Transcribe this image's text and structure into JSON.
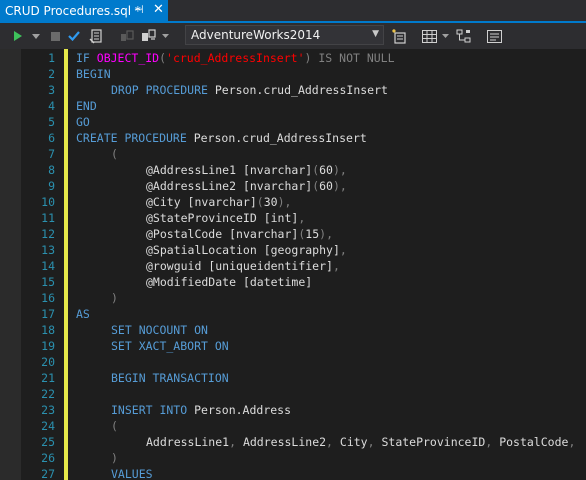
{
  "tab": {
    "title": "CRUD Procedures.sql *",
    "pin_glyph": "⊣",
    "close_glyph": "✕"
  },
  "toolbar": {
    "database": "AdventureWorks2014",
    "icons": [
      "execute-icon",
      "dropdown-icon",
      "stop-icon",
      "parse-check-icon",
      "display-plan-icon",
      "connect-icon",
      "change-connection-icon",
      "dropdown-arrow-icon",
      "query-options-icon",
      "results-grid-icon",
      "results-dropdown-icon",
      "include-plan-icon",
      "comment-icon"
    ]
  },
  "colors": {
    "keyword": "#569cd6",
    "function": "#ff00ff",
    "string": "#ff0000",
    "operator": "#808080",
    "line_number": "#2b91af",
    "change_marker": "#e5e84a",
    "accent": "#007acc"
  },
  "lines": [
    {
      "n": "1",
      "indent": 0,
      "tokens": [
        {
          "t": "IF ",
          "c": "kw"
        },
        {
          "t": "OBJECT_ID",
          "c": "fn"
        },
        {
          "t": "(",
          "c": "gray"
        },
        {
          "t": "'crud_AddressInsert'",
          "c": "str"
        },
        {
          "t": ") ",
          "c": "gray"
        },
        {
          "t": "IS NOT NULL",
          "c": "gray"
        }
      ]
    },
    {
      "n": "2",
      "indent": 0,
      "tokens": [
        {
          "t": "BEGIN",
          "c": "kw"
        }
      ]
    },
    {
      "n": "3",
      "indent": 5,
      "tokens": [
        {
          "t": "DROP PROCEDURE ",
          "c": "kw"
        },
        {
          "t": "Person.crud_AddressInsert",
          "c": "pl"
        }
      ]
    },
    {
      "n": "4",
      "indent": 0,
      "tokens": [
        {
          "t": "END",
          "c": "kw"
        }
      ]
    },
    {
      "n": "5",
      "indent": 0,
      "tokens": [
        {
          "t": "GO",
          "c": "kw"
        }
      ]
    },
    {
      "n": "6",
      "indent": 0,
      "tokens": [
        {
          "t": "CREATE PROCEDURE ",
          "c": "kw"
        },
        {
          "t": "Person.crud_AddressInsert",
          "c": "pl"
        }
      ]
    },
    {
      "n": "7",
      "indent": 5,
      "tokens": [
        {
          "t": "(",
          "c": "gray"
        }
      ]
    },
    {
      "n": "8",
      "indent": 10,
      "tokens": [
        {
          "t": "@AddressLine1 ",
          "c": "pl"
        },
        {
          "t": "[nvarchar]",
          "c": "pl"
        },
        {
          "t": "(",
          "c": "gray"
        },
        {
          "t": "60",
          "c": "pl"
        },
        {
          "t": "),",
          "c": "gray"
        }
      ]
    },
    {
      "n": "9",
      "indent": 10,
      "tokens": [
        {
          "t": "@AddressLine2 ",
          "c": "pl"
        },
        {
          "t": "[nvarchar]",
          "c": "pl"
        },
        {
          "t": "(",
          "c": "gray"
        },
        {
          "t": "60",
          "c": "pl"
        },
        {
          "t": "),",
          "c": "gray"
        }
      ]
    },
    {
      "n": "10",
      "indent": 10,
      "tokens": [
        {
          "t": "@City ",
          "c": "pl"
        },
        {
          "t": "[nvarchar]",
          "c": "pl"
        },
        {
          "t": "(",
          "c": "gray"
        },
        {
          "t": "30",
          "c": "pl"
        },
        {
          "t": "),",
          "c": "gray"
        }
      ]
    },
    {
      "n": "11",
      "indent": 10,
      "tokens": [
        {
          "t": "@StateProvinceID ",
          "c": "pl"
        },
        {
          "t": "[int]",
          "c": "pl"
        },
        {
          "t": ",",
          "c": "gray"
        }
      ]
    },
    {
      "n": "12",
      "indent": 10,
      "tokens": [
        {
          "t": "@PostalCode ",
          "c": "pl"
        },
        {
          "t": "[nvarchar]",
          "c": "pl"
        },
        {
          "t": "(",
          "c": "gray"
        },
        {
          "t": "15",
          "c": "pl"
        },
        {
          "t": "),",
          "c": "gray"
        }
      ]
    },
    {
      "n": "13",
      "indent": 10,
      "tokens": [
        {
          "t": "@SpatialLocation ",
          "c": "pl"
        },
        {
          "t": "[geography]",
          "c": "pl"
        },
        {
          "t": ",",
          "c": "gray"
        }
      ]
    },
    {
      "n": "14",
      "indent": 10,
      "tokens": [
        {
          "t": "@rowguid ",
          "c": "pl"
        },
        {
          "t": "[uniqueidentifier]",
          "c": "pl"
        },
        {
          "t": ",",
          "c": "gray"
        }
      ]
    },
    {
      "n": "15",
      "indent": 10,
      "tokens": [
        {
          "t": "@ModifiedDate ",
          "c": "pl"
        },
        {
          "t": "[datetime]",
          "c": "pl"
        }
      ]
    },
    {
      "n": "16",
      "indent": 5,
      "tokens": [
        {
          "t": ")",
          "c": "gray"
        }
      ]
    },
    {
      "n": "17",
      "indent": 0,
      "tokens": [
        {
          "t": "AS",
          "c": "kw"
        }
      ]
    },
    {
      "n": "18",
      "indent": 5,
      "tokens": [
        {
          "t": "SET NOCOUNT ON",
          "c": "kw"
        }
      ]
    },
    {
      "n": "19",
      "indent": 5,
      "tokens": [
        {
          "t": "SET XACT_ABORT ON",
          "c": "kw"
        }
      ]
    },
    {
      "n": "20",
      "indent": 0,
      "tokens": []
    },
    {
      "n": "21",
      "indent": 5,
      "tokens": [
        {
          "t": "BEGIN TRANSACTION",
          "c": "kw"
        }
      ]
    },
    {
      "n": "22",
      "indent": 0,
      "tokens": []
    },
    {
      "n": "23",
      "indent": 5,
      "tokens": [
        {
          "t": "INSERT INTO ",
          "c": "kw"
        },
        {
          "t": "Person.Address",
          "c": "pl"
        }
      ]
    },
    {
      "n": "24",
      "indent": 5,
      "tokens": [
        {
          "t": "(",
          "c": "gray"
        }
      ]
    },
    {
      "n": "25",
      "indent": 10,
      "tokens": [
        {
          "t": "AddressLine1",
          "c": "pl"
        },
        {
          "t": ", ",
          "c": "gray"
        },
        {
          "t": "AddressLine2",
          "c": "pl"
        },
        {
          "t": ", ",
          "c": "gray"
        },
        {
          "t": "City",
          "c": "pl"
        },
        {
          "t": ", ",
          "c": "gray"
        },
        {
          "t": "StateProvinceID",
          "c": "pl"
        },
        {
          "t": ", ",
          "c": "gray"
        },
        {
          "t": "PostalCode",
          "c": "pl"
        },
        {
          "t": ",",
          "c": "gray"
        }
      ]
    },
    {
      "n": "26",
      "indent": 5,
      "tokens": [
        {
          "t": ")",
          "c": "gray"
        }
      ]
    },
    {
      "n": "27",
      "indent": 5,
      "tokens": [
        {
          "t": "VALUES",
          "c": "kw"
        }
      ]
    }
  ]
}
